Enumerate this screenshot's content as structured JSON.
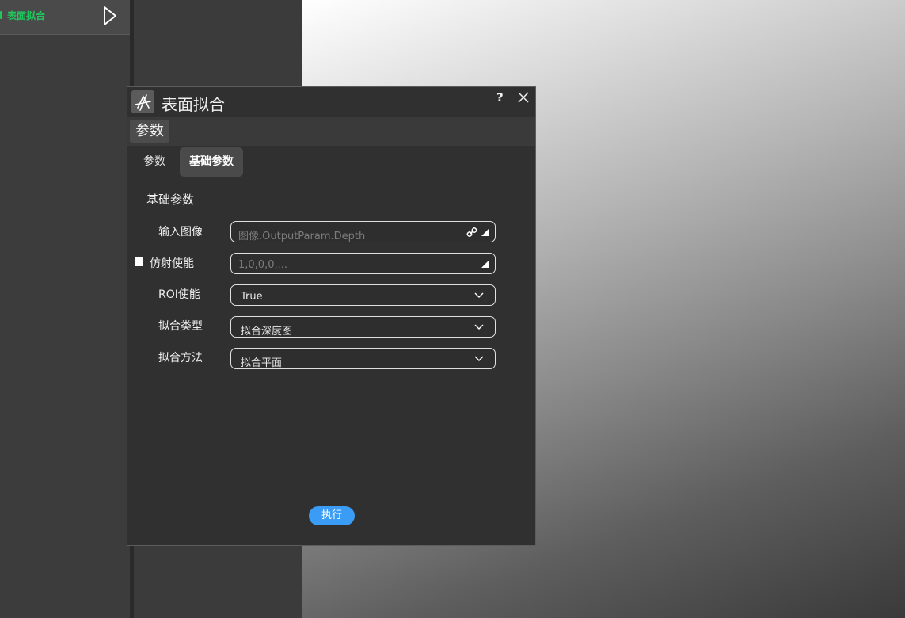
{
  "left_panel": {
    "item": {
      "label": "表面拟合",
      "status_color": "#22c55e"
    }
  },
  "dialog": {
    "title": "表面拟合",
    "help_label": "?",
    "section_label": "参数",
    "tabs": [
      {
        "label": "参数",
        "active": false
      },
      {
        "label": "基础参数",
        "active": true
      }
    ],
    "group_title": "基础参数",
    "fields": {
      "input_image": {
        "label": "输入图像",
        "placeholder": "图像.OutputParam.Depth"
      },
      "affine_enable": {
        "label": "仿射使能",
        "checked": true,
        "placeholder": "1,0,0,0,..."
      },
      "roi_enable": {
        "label": "ROI使能",
        "value": "True"
      },
      "fit_type": {
        "label": "拟合类型",
        "value": "拟合深度图"
      },
      "fit_method": {
        "label": "拟合方法",
        "value": "拟合平面"
      }
    },
    "run_label": "执行",
    "accent_color": "#3b9cf5"
  }
}
